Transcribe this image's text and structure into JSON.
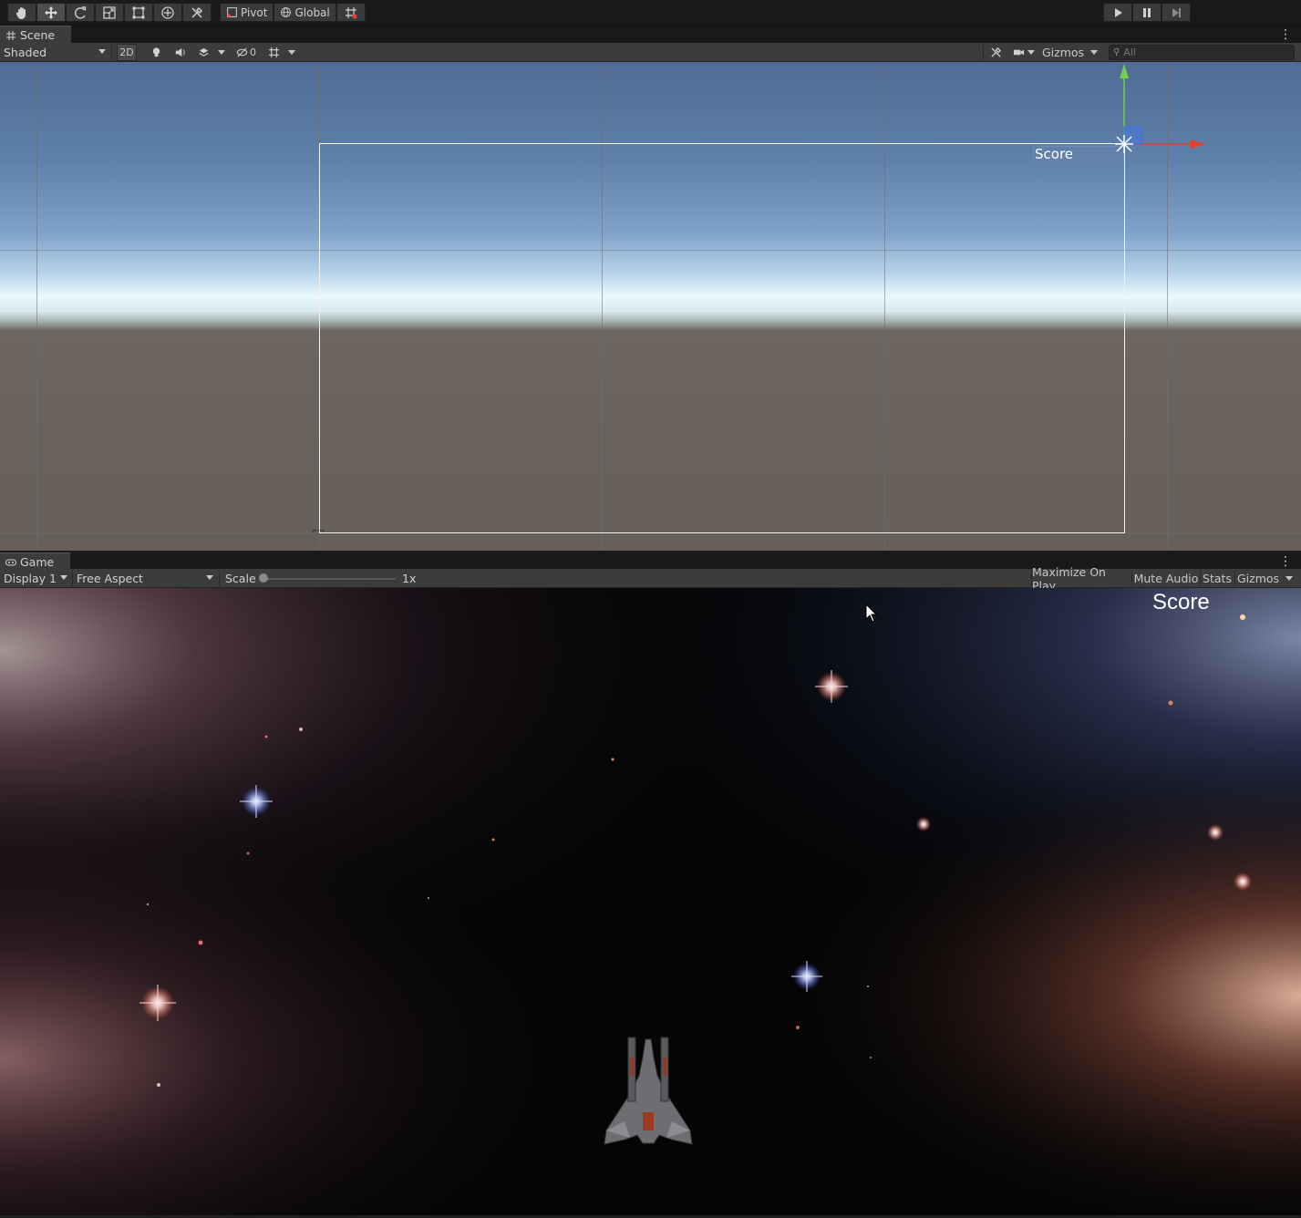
{
  "toolbar": {
    "tools": [
      "hand-tool",
      "move-tool",
      "rotate-tool",
      "scale-tool",
      "rect-tool",
      "transform-tool",
      "custom-tool"
    ],
    "pivot_label": "Pivot",
    "global_label": "Global",
    "play_controls": [
      "play",
      "pause",
      "step"
    ]
  },
  "scene": {
    "tab_label": "Scene",
    "shading_mode": "Shaded",
    "mode_2d": "2D",
    "hidden_count": "0",
    "gizmos_label": "Gizmos",
    "search_placeholder": "All",
    "score_text_label": "Score"
  },
  "game": {
    "tab_label": "Game",
    "display": "Display 1",
    "aspect": "Free Aspect",
    "scale_label": "Scale",
    "scale_value": "1x",
    "scale_fraction": 0.0,
    "maximize_label": "Maximize On Play",
    "mute_label": "Mute Audio",
    "stats_label": "Stats",
    "gizmos_label": "Gizmos",
    "score_text": "Score"
  },
  "colors": {
    "axis_y": "#6fd14a",
    "axis_x": "#e0412f",
    "axis_z": "#3f6fe0",
    "panel_bg": "#3c3c3c"
  }
}
